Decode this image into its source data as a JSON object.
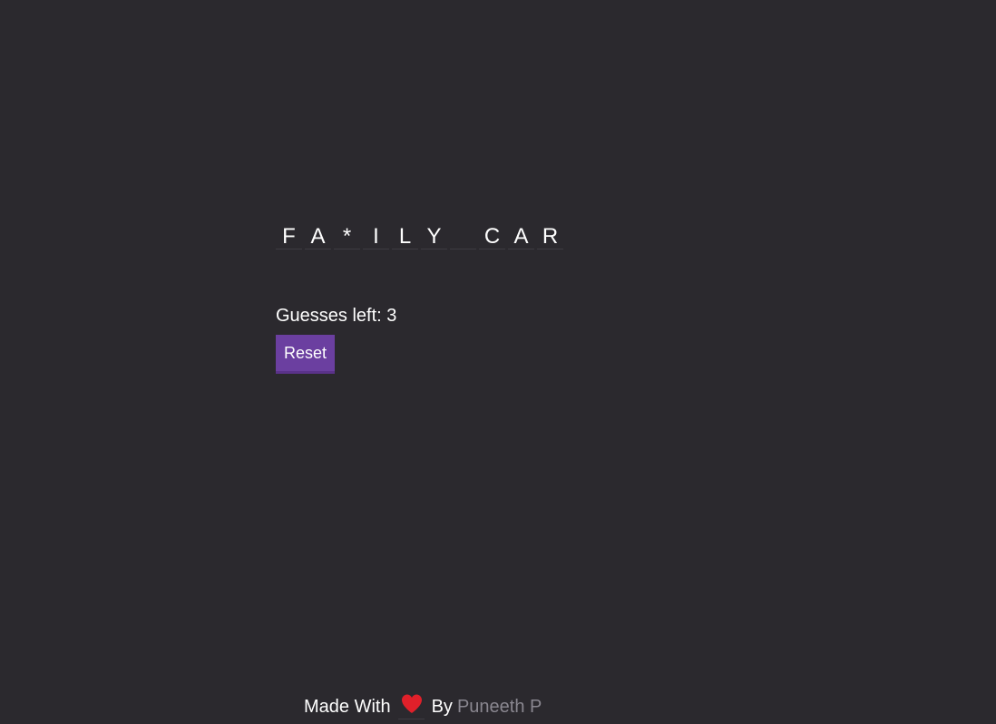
{
  "puzzle": {
    "letters": [
      "F",
      "A",
      "*",
      "I",
      "L",
      "Y",
      "",
      "C",
      "A",
      "R"
    ]
  },
  "status": {
    "guesses_text": "Guesses left: 3"
  },
  "controls": {
    "reset_label": "Reset"
  },
  "footer": {
    "made_with": "Made With",
    "heart_icon": "heart-icon",
    "by": "By",
    "author": "Puneeth P"
  },
  "colors": {
    "background": "#2b292e",
    "accent": "#6b3fa0",
    "heart": "#e0202a",
    "muted": "#8a8790"
  }
}
